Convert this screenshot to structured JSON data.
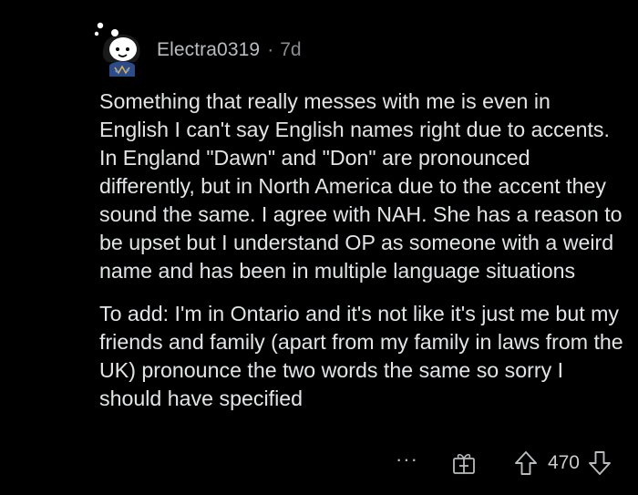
{
  "comment": {
    "username": "Electra0319",
    "separator": "·",
    "age": "7d",
    "paragraphs": [
      "Something that really messes with me is even in English I can't say English names right due to accents. In England \"Dawn\" and \"Don\" are pronounced differently, but in North America due to the accent they sound the same. I agree with NAH. She has a reason to be upset but I understand OP as someone with a weird name and has been in multiple language situations",
      "To add: I'm in Ontario and it's not like it's just me but my friends and family (apart from my family in laws from the UK) pronounce the two words the same so sorry I should have specified"
    ]
  },
  "actions": {
    "more_label": "···",
    "award_icon": "gift-box-icon",
    "upvote_icon": "arrow-up-icon",
    "score": "470",
    "downvote_icon": "arrow-down-icon"
  },
  "colors": {
    "background": "#000000",
    "text": "#e2e4e6",
    "meta": "#8a8d8f"
  }
}
